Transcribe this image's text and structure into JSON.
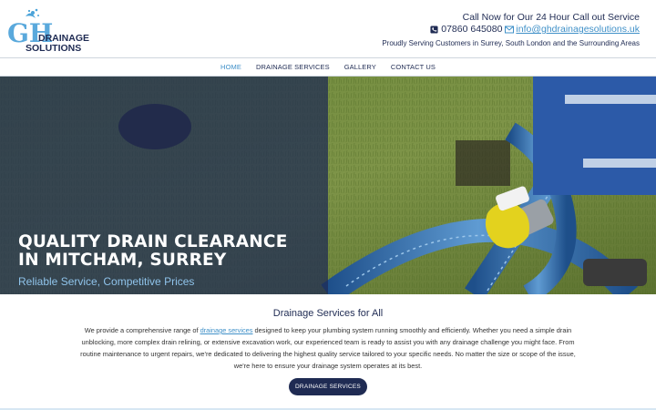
{
  "logo": {
    "initials": "GH",
    "line1": "DRAINAGE",
    "line2": "SOLUTIONS"
  },
  "header": {
    "call_line": "Call Now for Our 24 Hour Call out Service",
    "phone": "07860 645080",
    "email": "info@ghdrainagesolutions.uk",
    "serving": "Proudly Serving Customers in Surrey, South London and the Surrounding Areas"
  },
  "nav": {
    "items": [
      {
        "label": "HOME",
        "active": true
      },
      {
        "label": "DRAINAGE SERVICES",
        "active": false
      },
      {
        "label": "GALLERY",
        "active": false
      },
      {
        "label": "CONTACT US",
        "active": false
      }
    ]
  },
  "hero": {
    "title": "QUALITY DRAIN CLEARANCE IN MITCHAM, SURREY",
    "subtitle": "Reliable Service, Competitive Prices"
  },
  "section": {
    "title": "Drainage Services for All",
    "body_before_link": "We provide a comprehensive range of ",
    "link_text": "drainage services",
    "body_after_link": " designed to keep your plumbing system running smoothly and efficiently. Whether you need a simple drain unblocking, more complex drain relining, or extensive excavation work, our experienced team is ready to assist you with any drainage challenge you might face. From routine maintenance to urgent repairs, we're dedicated to delivering the highest quality service tailored to your specific needs. No matter the size or scope of the issue, we're here to ensure your drainage system operates at its best.",
    "button_label": "DRAINAGE SERVICES"
  },
  "colors": {
    "navy": "#1f2b53",
    "accent_blue": "#3f90c8",
    "hero_overlay": "#1f2b53"
  },
  "icons": {
    "phone": "phone-icon",
    "email": "envelope-icon"
  }
}
